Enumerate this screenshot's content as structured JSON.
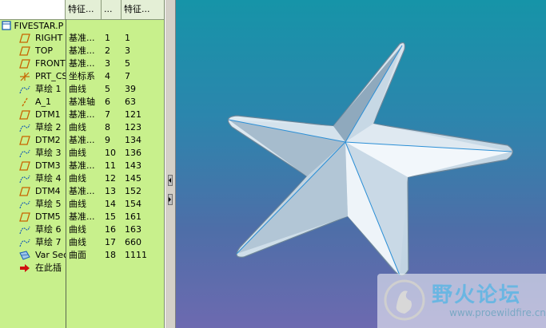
{
  "tree": {
    "root_label": "FIVESTAR.P",
    "headers": {
      "name": "",
      "feature": "特征...",
      "id": "...",
      "feature2": "特征..."
    },
    "rows": [
      {
        "icon": "datum-plane-icon",
        "name": "RIGHT",
        "feature": "基准...",
        "num": "1",
        "id": "1"
      },
      {
        "icon": "datum-plane-icon",
        "name": "TOP",
        "feature": "基准...",
        "num": "2",
        "id": "3"
      },
      {
        "icon": "datum-plane-icon",
        "name": "FRONT",
        "feature": "基准...",
        "num": "3",
        "id": "5"
      },
      {
        "icon": "coordinate-system-icon",
        "name": "PRT_CS",
        "feature": "坐标系",
        "num": "4",
        "id": "7"
      },
      {
        "icon": "sketch-icon",
        "name": "草绘 1",
        "feature": "曲线",
        "num": "5",
        "id": "39"
      },
      {
        "icon": "datum-axis-icon",
        "name": "A_1",
        "feature": "基准轴",
        "num": "6",
        "id": "63"
      },
      {
        "icon": "datum-plane-icon",
        "name": "DTM1",
        "feature": "基准...",
        "num": "7",
        "id": "121"
      },
      {
        "icon": "sketch-icon",
        "name": "草绘 2",
        "feature": "曲线",
        "num": "8",
        "id": "123"
      },
      {
        "icon": "datum-plane-icon",
        "name": "DTM2",
        "feature": "基准...",
        "num": "9",
        "id": "134"
      },
      {
        "icon": "sketch-icon",
        "name": "草绘 3",
        "feature": "曲线",
        "num": "10",
        "id": "136"
      },
      {
        "icon": "datum-plane-icon",
        "name": "DTM3",
        "feature": "基准...",
        "num": "11",
        "id": "143"
      },
      {
        "icon": "sketch-icon",
        "name": "草绘 4",
        "feature": "曲线",
        "num": "12",
        "id": "145"
      },
      {
        "icon": "datum-plane-icon",
        "name": "DTM4",
        "feature": "基准...",
        "num": "13",
        "id": "152"
      },
      {
        "icon": "sketch-icon",
        "name": "草绘 5",
        "feature": "曲线",
        "num": "14",
        "id": "154"
      },
      {
        "icon": "datum-plane-icon",
        "name": "DTM5",
        "feature": "基准...",
        "num": "15",
        "id": "161"
      },
      {
        "icon": "sketch-icon",
        "name": "草绘 6",
        "feature": "曲线",
        "num": "16",
        "id": "163"
      },
      {
        "icon": "sketch-icon",
        "name": "草绘 7",
        "feature": "曲线",
        "num": "17",
        "id": "660"
      },
      {
        "icon": "var-sec-sweep-icon",
        "name": "Var Sec",
        "feature": "曲面",
        "num": "18",
        "id": "1111"
      },
      {
        "icon": "insert-here-arrow-icon",
        "name": "在此插",
        "feature": "",
        "num": "",
        "id": ""
      }
    ]
  },
  "watermark": {
    "title": "野火论坛",
    "url": "www.proewildfire.cn"
  },
  "colors": {
    "tree_bg": "#c8f08c",
    "viewport_top": "#1694a8",
    "viewport_bottom": "#6d6ab0",
    "icon_orange": "#c86400",
    "icon_blue": "#1a5fb4"
  }
}
